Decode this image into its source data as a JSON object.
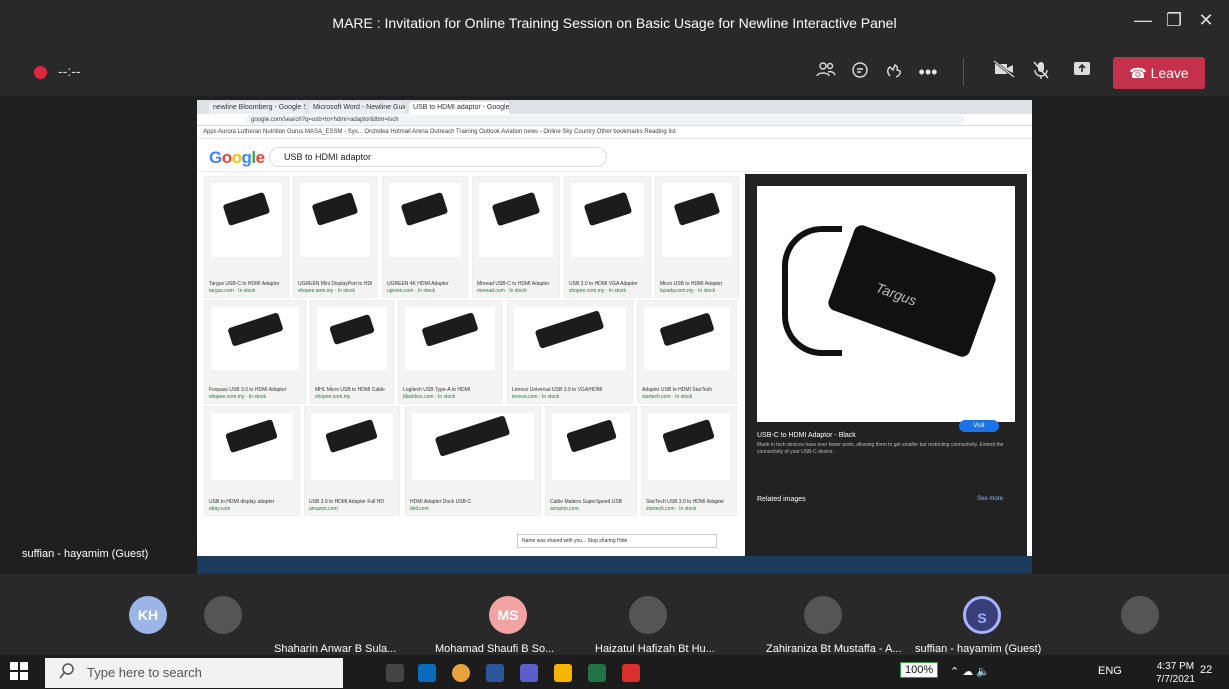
{
  "window": {
    "title": "MARE : Invitation for Online Training Session on Basic Usage for Newline Interactive Panel",
    "minimize": "—",
    "maximize": "❐",
    "close": "✕"
  },
  "meeting": {
    "timer": "--:--",
    "leave_label": "Leave",
    "accent": "#c4314b",
    "controls": [
      "people-icon",
      "chat-icon",
      "react-icon",
      "more-icon",
      "camera-off-icon",
      "mic-off-icon",
      "share-icon"
    ]
  },
  "shared_screen": {
    "tabs": [
      "newline Bloomberg - Google Se",
      "Microsoft Word - Newline Guide",
      "USB to HDMI adaptor - Google Se"
    ],
    "url": "google.com/search?q=usb+to+hdmi+adaptor&tbm=isch",
    "bookmarks": "Apps   Aurora Lutheran   Nutrition Gurus   MASA_ESSM - Sys...   Orchidea   Hotmail Arena   Outreach Training   Outlook   Aviation news - Online   Sky Country   Other bookmarks   Reading list",
    "google_logo": "Google",
    "search_query": "USB to HDMI adaptor",
    "results": [
      {
        "caption": "Targus USB-C to HDMI Adaptor",
        "source": "targus.com · In stock"
      },
      {
        "caption": "UGREEN Mini DisplayPort to HDMI",
        "source": "shopee.com.my · In stock"
      },
      {
        "caption": "UGREEN 4K HDMI Adapter",
        "source": "ugreen.com · In stock"
      },
      {
        "caption": "Moread USB-C to HDMI Adapter",
        "source": "moread.com · In stock"
      },
      {
        "caption": "USB 3.0 to HDMI VGA Adapter",
        "source": "shopee.com.my · In stock"
      },
      {
        "caption": "Micro USB to HDMI Adapter",
        "source": "lazada.com.my · In stock"
      },
      {
        "caption": "Foxpass USB 3.0 to HDMI Adaptor",
        "source": "shopee.com.my · In stock"
      },
      {
        "caption": "MHL Micro USB to HDMI Cable",
        "source": "shopee.com.my"
      },
      {
        "caption": "Logitech USB Type-A to HDMI",
        "source": "blackbox.com · In stock"
      },
      {
        "caption": "Lenovo Universal USB 3.0 to VGA/HDMI",
        "source": "lenovo.com · In stock"
      },
      {
        "caption": "Adapter USB to HDMI StarTech",
        "source": "startech.com · In stock"
      },
      {
        "caption": "USB to HDMI display adapter",
        "source": "ebay.com"
      },
      {
        "caption": "USB 3.0 to HDMI Adapter Full HD",
        "source": "amazon.com"
      },
      {
        "caption": "HDMI Adapter Dock USB-C",
        "source": "dell.com"
      },
      {
        "caption": "Cable Matters SuperSpeed USB",
        "source": "amazon.com"
      },
      {
        "caption": "StarTech USB 3.0 to HDMI Adapter",
        "source": "startech.com · In stock"
      }
    ],
    "preview": {
      "brand": "Targus",
      "title": "USB-C to HDMI Adaptor - Black",
      "description": "Made in tech devices have ever fewer ports, allowing them to get smaller but restricting connectivity. Extend the connectivity of your USB-C device.",
      "visit": "Visit",
      "related": "Related images",
      "see_more": "See more"
    },
    "popup": "Name was shared with you... Stop sharing  Hide"
  },
  "guest_label": "suffian - hayamim (Guest)",
  "participants": [
    {
      "initials": "KH",
      "name": "",
      "color": "#9bb6e6"
    },
    {
      "initials": "",
      "name": "Shaharin Anwar B Sula...",
      "color": "#555"
    },
    {
      "initials": "MS",
      "name": "Mohamad Shaufi B So...",
      "color": "#f2a3a3"
    },
    {
      "initials": "",
      "name": "Haizatul Hafizah Bt Hu...",
      "color": "#555"
    },
    {
      "initials": "",
      "name": "Zahiraniza Bt Mustaffa - A...",
      "color": "#555"
    },
    {
      "initials": "S",
      "name": "suffian - hayamim (Guest)",
      "color": "#8fa3ff"
    },
    {
      "initials": "",
      "name": "",
      "color": "#555"
    }
  ],
  "taskbar": {
    "search_placeholder": "Type here to search",
    "battery": "100%",
    "language": "ENG",
    "time": "4:37 PM",
    "date": "7/7/2021",
    "notifications": "22"
  }
}
